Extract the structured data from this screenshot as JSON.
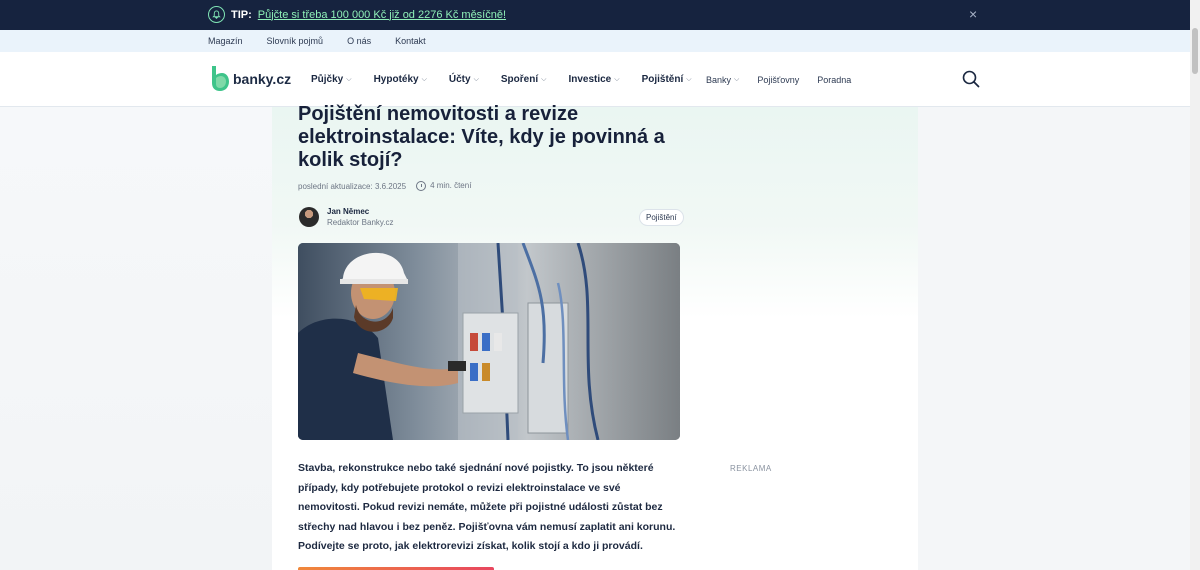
{
  "tip": {
    "label": "TIP:",
    "link": "Půjčte si třeba 100 000 Kč již od 2276 Kč měsíčně!",
    "close": "×"
  },
  "toplinks": [
    "Magazín",
    "Slovník pojmů",
    "O nás",
    "Kontakt"
  ],
  "logo": {
    "text": "banky.cz"
  },
  "nav": [
    "Půjčky",
    "Hypotéky",
    "Účty",
    "Spoření",
    "Investice",
    "Pojištění"
  ],
  "subnav": {
    "banky": "Banky",
    "pojistovny": "Pojišťovny",
    "poradna": "Poradna"
  },
  "article": {
    "title": "Pojištění nemovitosti a revize elektroinstalace: Víte, kdy je povinná a kolik stojí?",
    "updated": "poslední aktualizace: 3.6.2025",
    "read_time": "4 min. čtení",
    "author_name": "Jan Němec",
    "author_role": "Redaktor Banky.cz",
    "category": "Pojištění",
    "intro": "Stavba, rekonstrukce nebo také sjednání nové pojistky. To jsou některé případy, kdy potřebujete protokol o revizi elektroinstalace ve své nemovitosti. Pokud revizi nemáte, můžete při pojistné události zůstat bez střechy nad hlavou i bez peněz. Pojišťovna vám nemusí zaplatit ani korunu. Podívejte se proto, jak elektrorevizi získat, kolik stojí a kdo ji provádí."
  },
  "sidebar": {
    "ad_label": "REKLAMA"
  },
  "colors": {
    "navy": "#16233f",
    "accent": "#8ff0b8",
    "logo_green": "#3ec48a"
  }
}
